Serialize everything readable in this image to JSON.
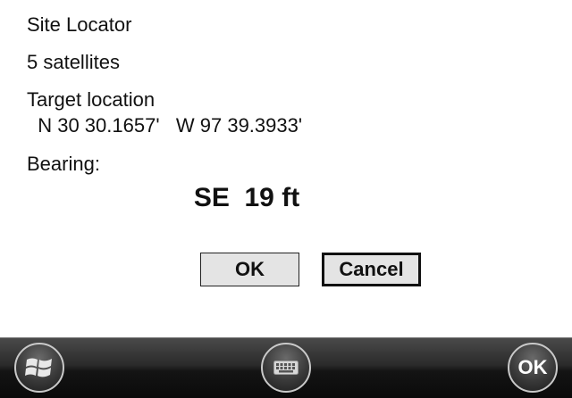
{
  "dialog": {
    "title": "Site Locator",
    "satellites": "5 satellites",
    "target_label": "Target location",
    "coordinates": "  N 30 30.1657'   W 97 39.3933'",
    "bearing_label": "Bearing:",
    "bearing_value": "SE  19 ft",
    "ok_label": "OK",
    "cancel_label": "Cancel"
  },
  "taskbar": {
    "start_icon": "windows-logo-icon",
    "keyboard_icon": "keyboard-icon",
    "ok_label": "OK"
  }
}
